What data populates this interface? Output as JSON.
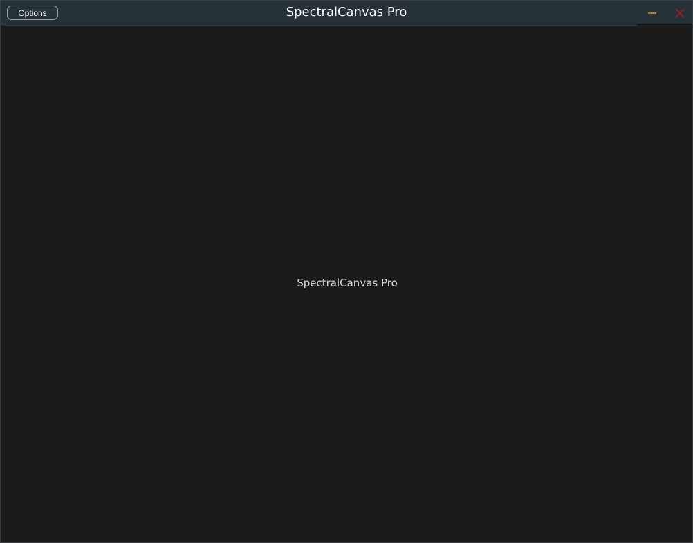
{
  "app": {
    "title": "SpectralCanvas Pro"
  },
  "titlebar": {
    "options_label": "Options",
    "minimize_icon": "minimize-icon",
    "close_icon": "close-icon",
    "colors": {
      "titlebar_bg": "#263238",
      "minimize": "#b8861b",
      "close": "#8b1d2c"
    }
  },
  "main": {
    "label": "SpectralCanvas Pro",
    "background": "#1b1b1b"
  }
}
